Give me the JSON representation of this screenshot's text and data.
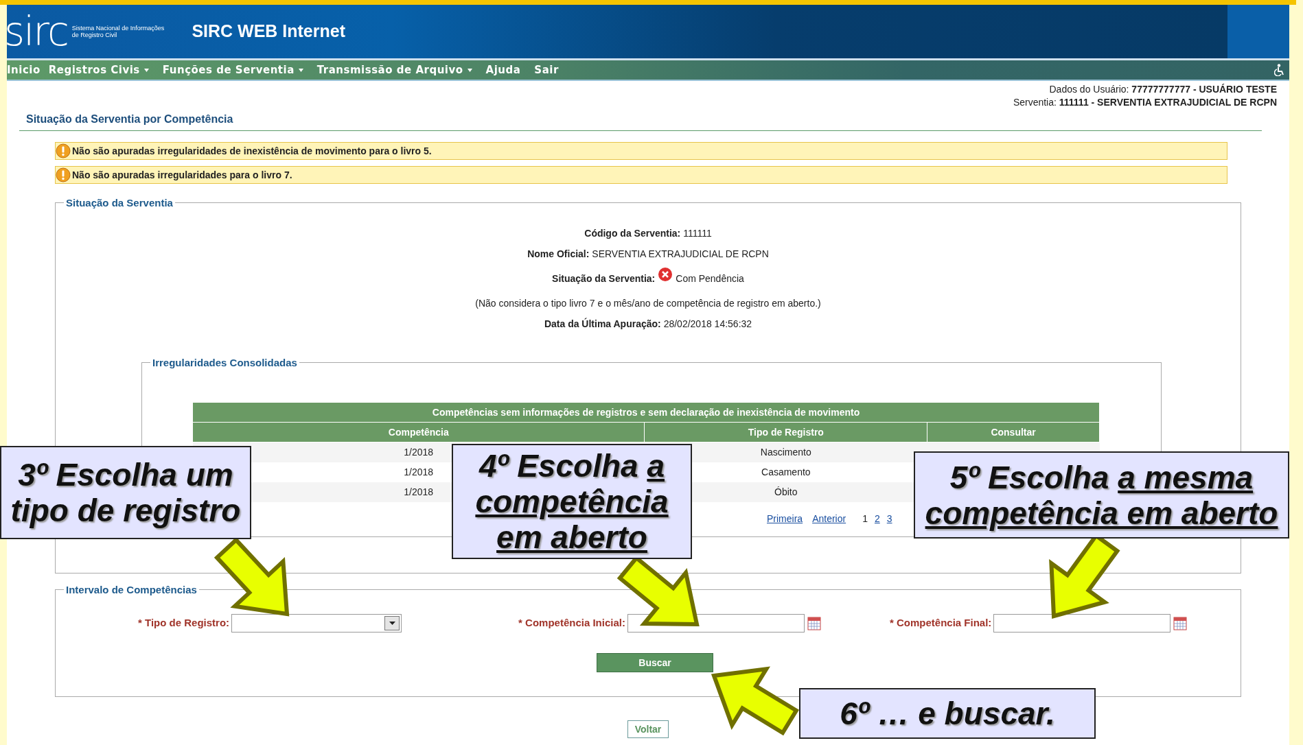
{
  "header": {
    "logo_text": "sirc",
    "logo_subtitle": [
      "Sistema Nacional de Informações",
      "de Registro Civil"
    ],
    "title": "SIRC WEB Internet"
  },
  "menu": [
    {
      "label": "Inicio",
      "dropdown": false
    },
    {
      "label": "Registros Civis",
      "dropdown": true
    },
    {
      "label": "Funções de Serventia",
      "dropdown": true
    },
    {
      "label": "Transmissão de Arquivo",
      "dropdown": true
    },
    {
      "label": "Ajuda",
      "dropdown": false
    },
    {
      "label": "Sair",
      "dropdown": false
    }
  ],
  "user_info": [
    "Dados do Usuário: **77777777777 - USUÁRIO TESTE**",
    "Serventia: **111111 - SERVENTIA EXTRAJUDICIAL DE RCPN**"
  ],
  "page_title": "Situação da Serventia por Competência",
  "alerts": [
    {
      "kind": "warning",
      "text": "Não são apuradas irregularidades de inexistência de movimento para o livro 5."
    },
    {
      "kind": "warning",
      "text": "Não são apuradas irregularidades para o livro 7."
    }
  ],
  "status_section": {
    "legend": "Situação da Serventia",
    "lines": [
      {
        "kind": "field",
        "text": "**Código da Serventia:** 111111"
      },
      {
        "kind": "field",
        "text": "**Nome Oficial:** SERVENTIA EXTRAJUDICIAL DE RCPN"
      },
      {
        "kind": "status",
        "text": "**Situação da Serventia:**",
        "value": "Com Pendência"
      },
      {
        "kind": "note",
        "text": "(Não considera o tipo livro 7 e o mês/ano de competência de registro em aberto.)"
      },
      {
        "kind": "field",
        "text": "**Data da Última Apuração:** 28/02/2018 14:56:32"
      }
    ]
  },
  "irregularities": {
    "legend": "Irregularidades Consolidadas",
    "table": {
      "title": "Competências sem informações de registros e sem declaração de inexistência de movimento",
      "columns": [
        "Competência",
        "Tipo de Registro",
        "Consultar"
      ],
      "rows": [
        [
          "1/2018",
          "Nascimento"
        ],
        [
          "1/2018",
          "Casamento"
        ],
        [
          "1/2018",
          "Óbito"
        ]
      ]
    },
    "pagination": [
      {
        "label": "Primeira",
        "kind": "link",
        "selected": false
      },
      {
        "label": "Anterior",
        "kind": "link",
        "selected": false
      },
      {
        "label": "1",
        "kind": "page",
        "selected": true
      },
      {
        "label": "2",
        "kind": "page",
        "selected": false
      },
      {
        "label": "3",
        "kind": "page",
        "selected": false
      }
    ]
  },
  "interval": {
    "legend": "Intervalo de Competências",
    "fields": [
      {
        "kind": "select",
        "label": "* Tipo de Registro:"
      },
      {
        "kind": "date",
        "label": "* Competência Inicial:"
      },
      {
        "kind": "date",
        "label": "* Competência Final:"
      }
    ],
    "search_button": "Buscar"
  },
  "back_button": "Voltar",
  "callouts": [
    {
      "text": "3º Escolha um tipo de registro"
    },
    {
      "text": "4º Escolha",
      "underlined": "a competência em aberto"
    },
    {
      "text": "5º Escolha",
      "underlined": "a mesma competência em aberto"
    },
    {
      "text": "6º … e buscar."
    }
  ]
}
